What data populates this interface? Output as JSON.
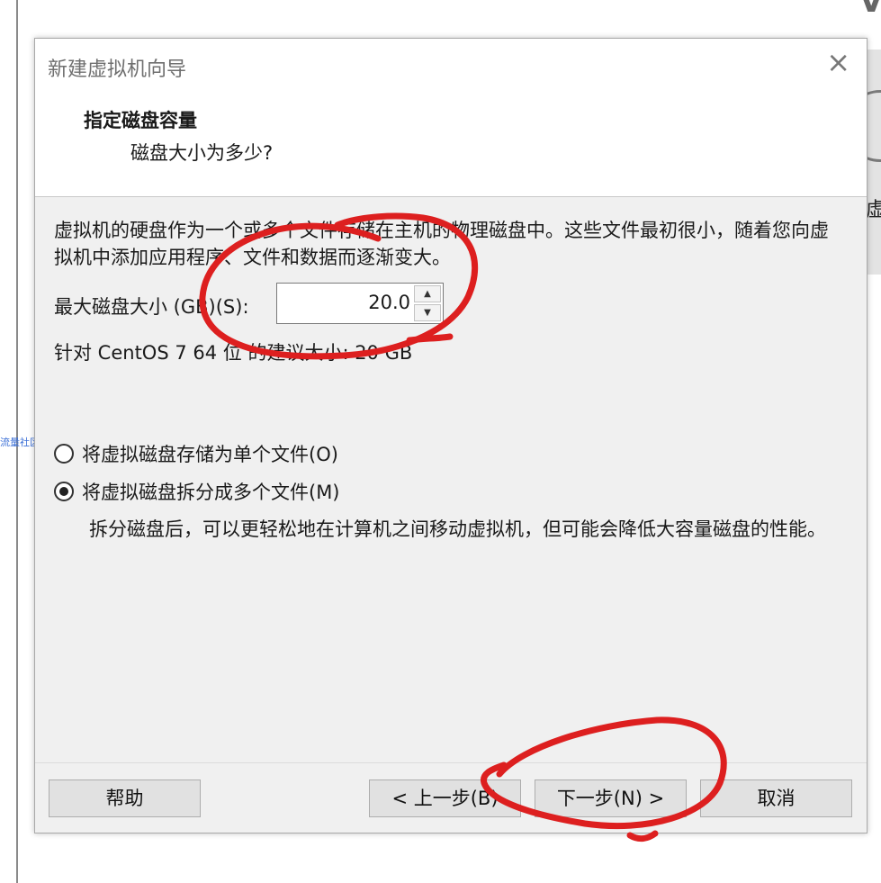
{
  "background": {
    "side_label": "流量社区",
    "right_char": "虚",
    "corner_char": "V"
  },
  "dialog": {
    "title": "新建虚拟机向导",
    "close_glyph": "×",
    "header": {
      "title": "指定磁盘容量",
      "subtitle": "磁盘大小为多少?"
    },
    "description": "虚拟机的硬盘作为一个或多个文件存储在主机的物理磁盘中。这些文件最初很小，随着您向虚拟机中添加应用程序、文件和数据而逐渐变大。",
    "max_size_label": "最大磁盘大小 (GB)(S):",
    "max_size_value": "20.0",
    "recommendation": "针对 CentOS 7 64 位 的建议大小: 20 GB",
    "options": [
      {
        "label": "将虚拟磁盘存储为单个文件(O)",
        "selected": false
      },
      {
        "label": "将虚拟磁盘拆分成多个文件(M)",
        "selected": true
      }
    ],
    "split_description": "拆分磁盘后，可以更轻松地在计算机之间移动虚拟机，但可能会降低大容量磁盘的性能。",
    "buttons": {
      "help": "帮助",
      "prev": "< 上一步(B)",
      "next": "下一步(N) >",
      "cancel": "取消"
    }
  },
  "annotation_color": "#dd1f1f"
}
